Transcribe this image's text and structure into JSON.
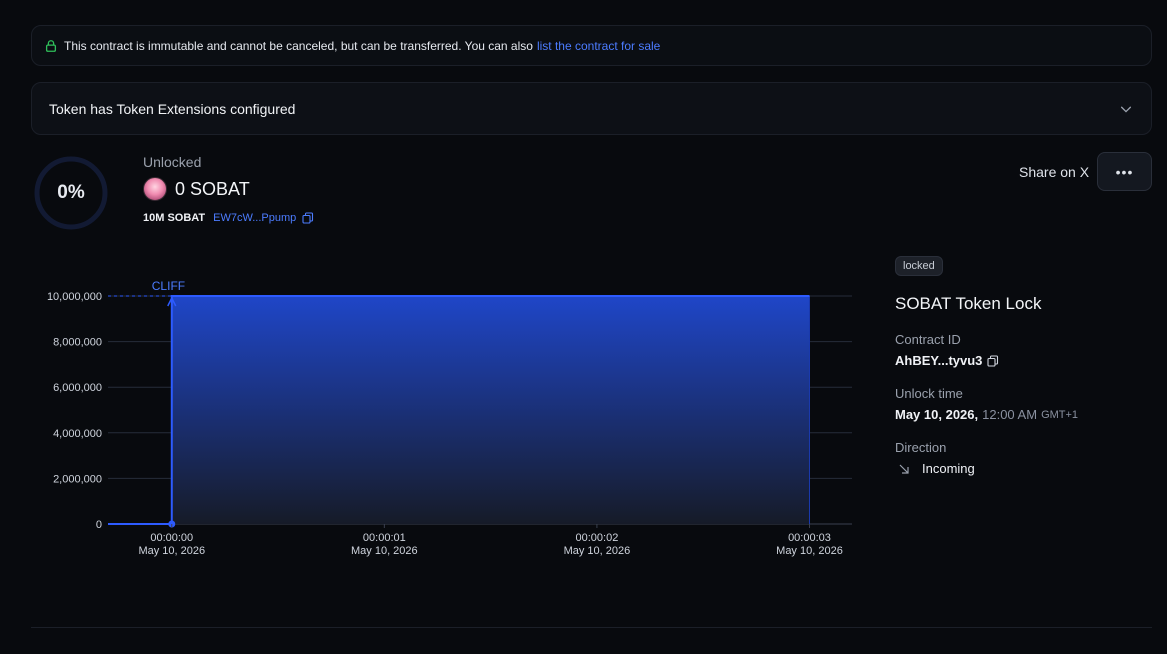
{
  "banner": {
    "icon": "lock-icon",
    "text": "This contract is immutable and cannot be canceled, but can be transferred. You can also",
    "link": "list the contract for sale",
    "icon_color": "#2fbf5a",
    "link_color": "#4c7cff"
  },
  "extensions": {
    "label": "Token has Token Extensions configured",
    "icon": "chevron-down-icon"
  },
  "progress": {
    "percent_label": "0%",
    "fraction": 0
  },
  "summary": {
    "unlocked_label": "Unlocked",
    "amount": "0 SOBAT",
    "total": "10M SOBAT",
    "address": "EW7cW...Ppump"
  },
  "actions": {
    "share": "Share on X",
    "more": "•••"
  },
  "chart_data": {
    "type": "area",
    "x": [
      "00:00:00\nMay 10, 2026",
      "00:00:01\nMay 10, 2026",
      "00:00:02\nMay 10, 2026",
      "00:00:03\nMay 10, 2026"
    ],
    "x_ticks": [
      {
        "time": "00:00:00",
        "date": "May 10, 2026"
      },
      {
        "time": "00:00:01",
        "date": "May 10, 2026"
      },
      {
        "time": "00:00:02",
        "date": "May 10, 2026"
      },
      {
        "time": "00:00:03",
        "date": "May 10, 2026"
      }
    ],
    "y_ticks": [
      "0",
      "2,000,000",
      "4,000,000",
      "6,000,000",
      "8,000,000",
      "10,000,000"
    ],
    "y_values": [
      0,
      2000000,
      4000000,
      6000000,
      8000000,
      10000000
    ],
    "ylim": [
      0,
      10000000
    ],
    "xlim_seconds": [
      -0.3,
      3.2
    ],
    "series": [
      {
        "points": [
          [
            -0.3,
            0
          ],
          [
            0,
            0
          ],
          [
            0,
            10000000
          ],
          [
            3,
            10000000
          ]
        ]
      }
    ],
    "annotation": {
      "text": "CLIFF",
      "x": 0
    },
    "color": "#2d5bff",
    "grid": true
  },
  "details": {
    "badge": "locked",
    "title": "SOBAT Token Lock",
    "contract_id_label": "Contract ID",
    "contract_id": "AhBEY...tyvu3",
    "unlock_label": "Unlock time",
    "unlock_date": "May 10, 2026,",
    "unlock_time": "12:00 AM",
    "unlock_tz": "GMT+1",
    "direction_label": "Direction",
    "direction": "Incoming",
    "direction_icon": "arrow-down-right-icon"
  }
}
